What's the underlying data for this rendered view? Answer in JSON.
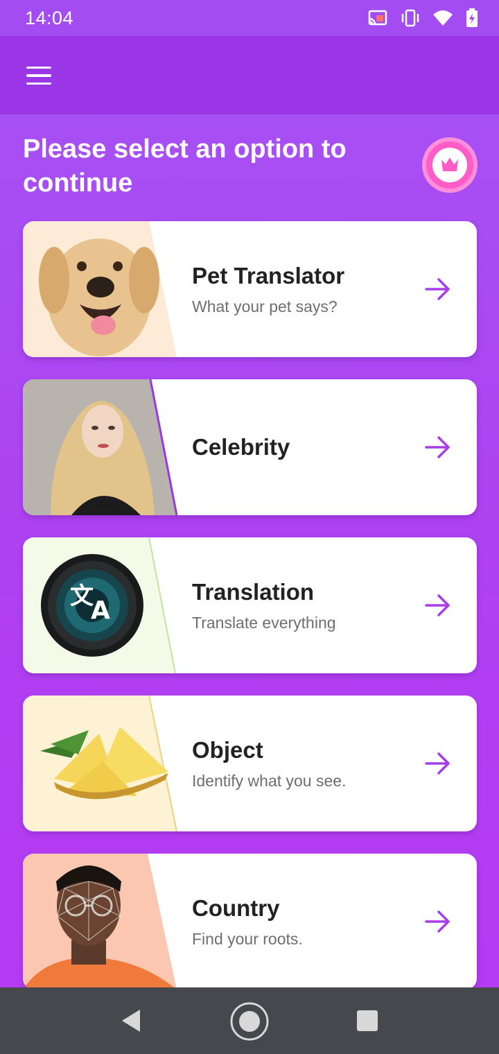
{
  "status_bar": {
    "time": "14:04",
    "icons": [
      "cast-icon",
      "vibrate-icon",
      "wifi-icon",
      "battery-charging-icon"
    ]
  },
  "app_bar": {
    "menu_icon": "hamburger-menu-icon"
  },
  "header": {
    "title": "Please select an option to continue",
    "premium_icon": "crown-icon"
  },
  "options": [
    {
      "title": "Pet Translator",
      "subtitle": "What your pet says?",
      "image": "dog-photo",
      "accent": "#fdebd8"
    },
    {
      "title": "Celebrity",
      "subtitle": "",
      "image": "celebrity-portrait",
      "accent": "#9a36e5"
    },
    {
      "title": "Translation",
      "subtitle": "Translate everything",
      "image": "translate-lens-icon",
      "accent": "#f3fbe8"
    },
    {
      "title": "Object",
      "subtitle": "Identify what you see.",
      "image": "pineapple-photo",
      "accent": "#fdf3d4"
    },
    {
      "title": "Country",
      "subtitle": "Find your roots.",
      "image": "face-scan-portrait",
      "accent": "#fbc7b0"
    }
  ],
  "colors": {
    "background": "#ae44f3",
    "app_bar": "#9a36e5",
    "arrow": "#a63de8",
    "premium_badge": "#ff66cc",
    "nav_bar": "#46484d"
  },
  "nav_bar": {
    "items": [
      "back-icon",
      "home-icon",
      "recents-icon"
    ]
  }
}
